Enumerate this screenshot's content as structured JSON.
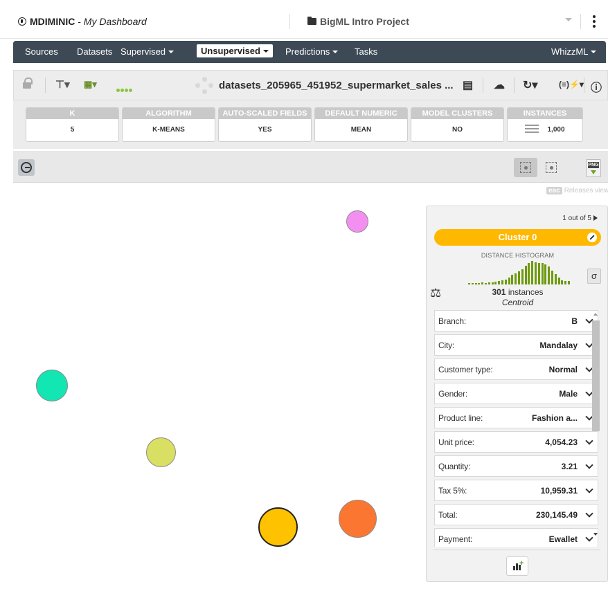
{
  "header": {
    "user": "MDIMINIC",
    "dashboard": "My Dashboard",
    "project": "BigML Intro Project"
  },
  "nav": {
    "items": [
      "Sources",
      "Datasets",
      "Supervised",
      "Unsupervised",
      "Predictions",
      "Tasks"
    ],
    "right": "WhizzML"
  },
  "toolbar": {
    "dataset_title": "datasets_205965_451952_supermarket_sales ..."
  },
  "summary": [
    {
      "label": "K",
      "value": "5"
    },
    {
      "label": "ALGORITHM",
      "value": "K-MEANS"
    },
    {
      "label": "AUTO-SCALED FIELDS",
      "value": "YES"
    },
    {
      "label": "DEFAULT NUMERIC",
      "value": "MEAN"
    },
    {
      "label": "MODEL CLUSTERS",
      "value": "NO"
    },
    {
      "label": "INSTANCES",
      "value": "1,000"
    }
  ],
  "releases": {
    "badge": "eac",
    "text": "Releases view"
  },
  "clusters": [
    {
      "color": "#f48ff2"
    },
    {
      "color": "#12e6b3"
    },
    {
      "color": "#d9df62"
    },
    {
      "color": "#ffc200"
    },
    {
      "color": "#fb7630"
    }
  ],
  "panel": {
    "pager": "1 out of 5",
    "cluster_name": "Cluster 0",
    "histogram_title": "DISTANCE HISTOGRAM",
    "histogram_levels": [
      0.05,
      0.06,
      0.06,
      0.07,
      0.08,
      0.07,
      0.09,
      0.1,
      0.12,
      0.14,
      0.18,
      0.22,
      0.3,
      0.4,
      0.48,
      0.55,
      0.65,
      0.8,
      0.9,
      1.0,
      0.95,
      0.92,
      0.9,
      0.85,
      0.75,
      0.6,
      0.45,
      0.3,
      0.18,
      0.15,
      0.16
    ],
    "sigma": "σ",
    "instances_count": "301",
    "instances_label": "instances",
    "centroid_label": "Centroid",
    "fields": [
      {
        "name": "Branch:",
        "value": "B"
      },
      {
        "name": "City:",
        "value": "Mandalay"
      },
      {
        "name": "Customer type:",
        "value": "Normal"
      },
      {
        "name": "Gender:",
        "value": "Male"
      },
      {
        "name": "Product line:",
        "value": "Fashion a..."
      },
      {
        "name": "Unit price:",
        "value": "4,054.23"
      },
      {
        "name": "Quantity:",
        "value": "3.21"
      },
      {
        "name": "Tax 5%:",
        "value": "10,959.31"
      },
      {
        "name": "Total:",
        "value": "230,145.49"
      },
      {
        "name": "Payment:",
        "value": "Ewallet"
      }
    ]
  }
}
